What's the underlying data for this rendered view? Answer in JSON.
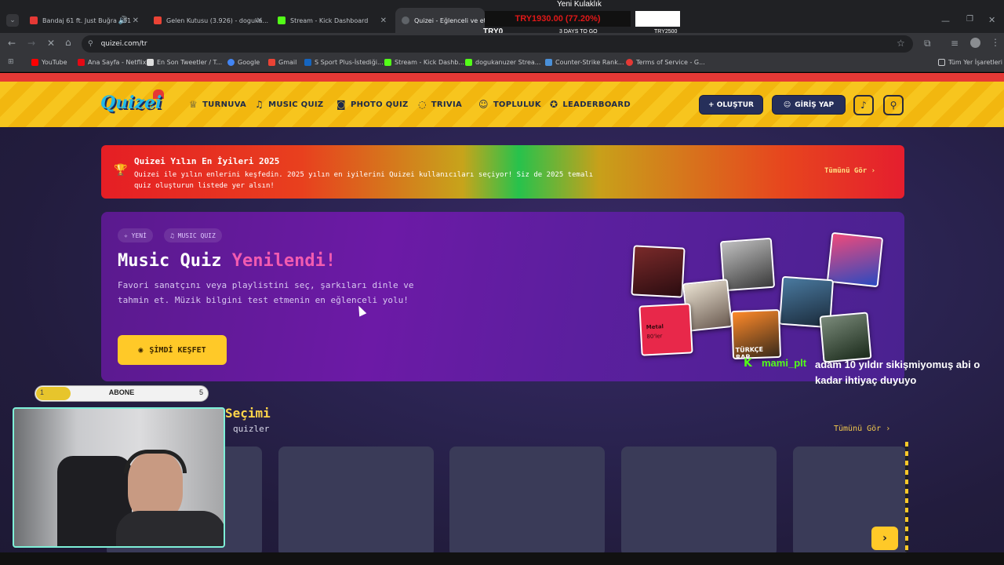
{
  "tabs": [
    {
      "title": "Bandaj 61 ft. Just Buğra - 61",
      "color": "#e53935"
    },
    {
      "title": "Gelen Kutusu (3.926) - doguka...",
      "color": "#ea4335"
    },
    {
      "title": "Stream - Kick Dashboard",
      "color": "#53fc18"
    },
    {
      "title": "Quizei - Eğlenceli ve etkile",
      "color": "#5f6368"
    }
  ],
  "address": {
    "url": "quizei.com/tr"
  },
  "bookmarks": [
    {
      "label": "YouTube",
      "color": "#ff0000"
    },
    {
      "label": "Ana Sayfa - Netflix",
      "color": "#e50914"
    },
    {
      "label": "En Son Tweetler / T...",
      "color": "#ffffff"
    },
    {
      "label": "Google",
      "color": "#4285f4"
    },
    {
      "label": "Gmail",
      "color": "#ea4335"
    },
    {
      "label": "S Sport Plus-İstediği...",
      "color": "#1565c0"
    },
    {
      "label": "Stream - Kick Dashb...",
      "color": "#53fc18"
    },
    {
      "label": "dogukanuzer Strea...",
      "color": "#53fc18"
    },
    {
      "label": "Counter-Strike Rank...",
      "color": "#4a90d9"
    },
    {
      "label": "Terms of Service - G...",
      "color": "#e53935"
    }
  ],
  "bookmarks_all": "Tüm Yer İşaretleri",
  "overlay": {
    "title": "Yeni Kulaklık",
    "price": "TRY1930.00 (77.20%)",
    "left": "TRY0",
    "days": "3 DAYS TO GO",
    "right": "TRY2500"
  },
  "site": {
    "logo": "Quizei",
    "nav": [
      {
        "label": "TURNUVA",
        "icon": "trophy-icon",
        "glyph": "♕"
      },
      {
        "label": "MUSIC QUIZ",
        "icon": "music-icon",
        "glyph": "♫"
      },
      {
        "label": "PHOTO QUIZ",
        "icon": "camera-icon",
        "glyph": "◙"
      },
      {
        "label": "TRIVIA",
        "icon": "chat-icon",
        "glyph": "◌"
      },
      {
        "label": "TOPLULUK",
        "icon": "users-icon",
        "glyph": "☺"
      },
      {
        "label": "LEADERBOARD",
        "icon": "medal-icon",
        "glyph": "✪"
      }
    ],
    "create_button": "+ OLUŞTUR",
    "login_button": "GİRİŞ YAP"
  },
  "banner": {
    "title": "Quizei Yılın En İyileri 2025",
    "desc": "Quizei ile yılın enlerini keşfedin. 2025 yılın en iyilerini Quizei kullanıcıları seçiyor! Siz de 2025 temalı quiz oluşturun listede yer alsın!",
    "link": "Tümünü Gör ›"
  },
  "hero": {
    "pill_new": "✧ YENİ",
    "pill_music": "♫ MUSIC QUIZ",
    "title_a": "Music Quiz",
    "title_b": "Yenilendi!",
    "desc": "Favori sanatçını veya playlistini seç, şarkıları dinle ve tahmin et. Müzik bilgini test etmenin en eğlenceli yolu!",
    "button": "ŞİMDİ KEŞFET",
    "album_a": "Metal",
    "album_b": "80'ler",
    "album_c": "TÜRKÇE RAP"
  },
  "section": {
    "title": "Seçimi",
    "subtitle": "quizler",
    "link": "Tümünü Gör ›"
  },
  "chat": {
    "user": "mami_plt",
    "message": "adam 10 yıldır sikişmiyomuş abi o kadar ihtiyaç duyuyo"
  },
  "subs": {
    "label": "ABONE",
    "current": "1",
    "goal": "5",
    "progress": 0.2
  },
  "colors": {
    "accent": "#ffc928",
    "navy": "#262f5a",
    "pink": "#f25bb0",
    "kick_green": "#53fc18"
  }
}
